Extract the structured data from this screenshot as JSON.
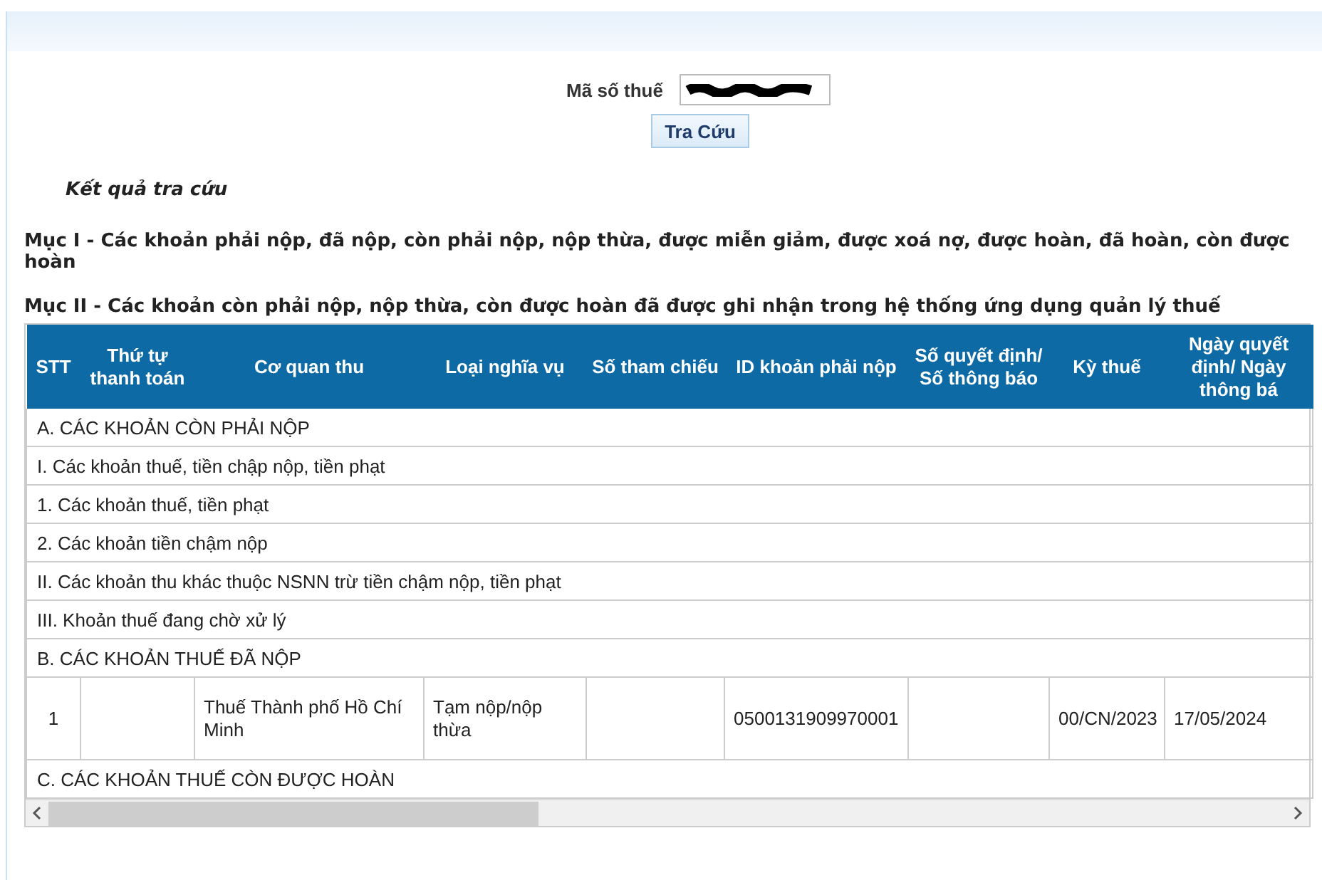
{
  "search": {
    "label": "Mã số thuế",
    "button": "Tra Cứu"
  },
  "result_title": "Kết quả tra cứu",
  "sections": [
    "Mục I - Các khoản phải nộp, đã nộp, còn phải nộp, nộp thừa, được miễn giảm, được xoá nợ, được hoàn, đã hoàn, còn được hoàn",
    "Mục II - Các khoản còn phải nộp, nộp thừa, còn được hoàn đã được ghi nhận trong hệ thống ứng dụng quản lý thuế"
  ],
  "table": {
    "columns": [
      "STT",
      "Thứ tự thanh toán",
      "Cơ quan thu",
      "Loại nghĩa vụ",
      "Số tham chiếu",
      "ID khoản phải nộp",
      "Số quyết định/ Số thông báo",
      "Kỳ thuế",
      "Ngày quyết định/ Ngày thông bá"
    ],
    "rows": [
      {
        "kind": "group",
        "text": "A. CÁC KHOẢN CÒN PHẢI NỘP"
      },
      {
        "kind": "group",
        "text": "I. Các khoản thuế, tiền chập nộp, tiền phạt"
      },
      {
        "kind": "group",
        "text": "1. Các khoản thuế, tiền phạt"
      },
      {
        "kind": "group",
        "text": "2. Các khoản tiền chậm nộp"
      },
      {
        "kind": "group",
        "text": "II. Các khoản thu khác thuộc NSNN trừ tiền chậm nộp, tiền phạt"
      },
      {
        "kind": "group",
        "text": "III. Khoản thuế đang chờ xử lý"
      },
      {
        "kind": "group",
        "text": "B. CÁC KHOẢN THUẾ ĐÃ NỘP"
      },
      {
        "kind": "data",
        "cells": [
          "1",
          null,
          "Thuế Thành phố Hồ Chí Minh",
          "Tạm nộp/nộp thừa",
          null,
          "0500131909970001",
          null,
          "00/CN/2023",
          "17/05/2024"
        ]
      },
      {
        "kind": "group",
        "text": "C. CÁC KHOẢN THUẾ CÒN ĐƯỢC HOÀN"
      }
    ]
  }
}
